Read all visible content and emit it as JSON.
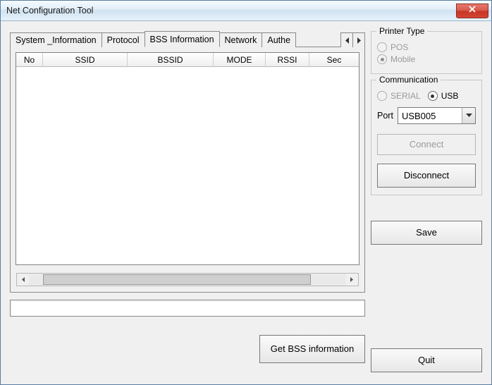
{
  "window": {
    "title": "Net Configuration Tool"
  },
  "tabs": {
    "system_information": "System _Information",
    "protocol": "Protocol",
    "bss_information": "BSS Information",
    "network": "Network",
    "authentication": "Authe"
  },
  "table": {
    "columns": {
      "no": "No",
      "ssid": "SSID",
      "bssid": "BSSID",
      "mode": "MODE",
      "rssi": "RSSI",
      "sec": "Sec"
    }
  },
  "buttons": {
    "get_bss": "Get BSS information",
    "connect": "Connect",
    "disconnect": "Disconnect",
    "save": "Save",
    "quit": "Quit"
  },
  "printer_type": {
    "legend": "Printer Type",
    "pos": "POS",
    "mobile": "Mobile"
  },
  "communication": {
    "legend": "Communication",
    "serial": "SERIAL",
    "usb": "USB",
    "port_label": "Port",
    "port_value": "USB005"
  }
}
